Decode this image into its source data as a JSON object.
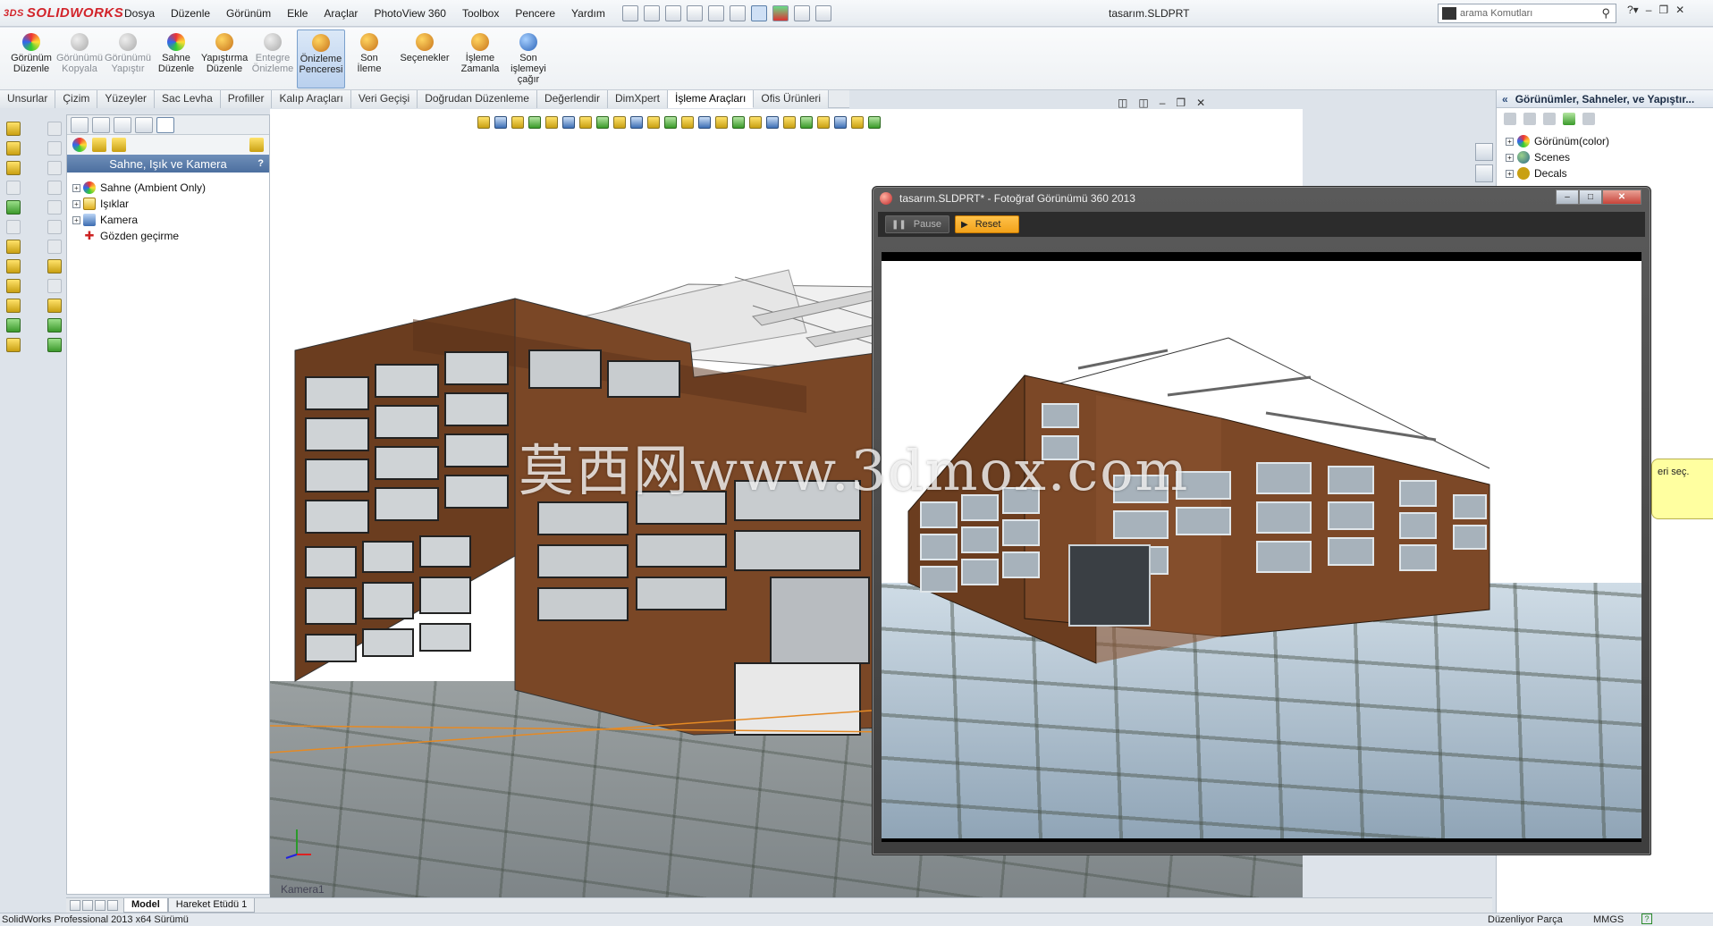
{
  "app": {
    "logo": "SOLIDWORKS",
    "menu": [
      "Dosya",
      "Düzenle",
      "Görünüm",
      "Ekle",
      "Araçlar",
      "PhotoView 360",
      "Toolbox",
      "Pencere",
      "Yardım"
    ],
    "document_title": "tasarım.SLDPRT",
    "search_placeholder": "arama Komutları"
  },
  "command_manager": {
    "buttons": [
      {
        "label": "Görünüm\nDüzenle",
        "state": "normal"
      },
      {
        "label": "Görünümü\nKopyala",
        "state": "disabled"
      },
      {
        "label": "Görünümü\nYapıştır",
        "state": "disabled"
      },
      {
        "label": "Sahne\nDüzenle",
        "state": "normal"
      },
      {
        "label": "Yapıştırma\nDüzenle",
        "state": "normal"
      },
      {
        "label": "Entegre\nÖnizleme",
        "state": "disabled"
      },
      {
        "label": "Önizleme\nPenceresi",
        "state": "active"
      },
      {
        "label": "Son\nİleme",
        "state": "normal"
      },
      {
        "label": "Seçenekler",
        "state": "normal"
      },
      {
        "label": "İşleme\nZamanla",
        "state": "normal"
      },
      {
        "label": "Son\nişlemeyi\nçağır",
        "state": "normal"
      }
    ]
  },
  "tabs": [
    "Unsurlar",
    "Çizim",
    "Yüzeyler",
    "Sac Levha",
    "Profiller",
    "Kalıp Araçları",
    "Veri Geçişi",
    "Doğrudan Düzenleme",
    "Değerlendir",
    "DimXpert",
    "İşleme Araçları",
    "Ofis Ürünleri"
  ],
  "active_tab": "İşleme Araçları",
  "feature_manager": {
    "header": "Sahne, Işık ve Kamera",
    "help": "?",
    "tree": [
      {
        "label": "Sahne (Ambient Only)",
        "icon": "scene-icon",
        "expandable": true
      },
      {
        "label": "Işıklar",
        "icon": "lights-icon",
        "expandable": true
      },
      {
        "label": "Kamera",
        "icon": "camera-icon",
        "expandable": true
      },
      {
        "label": "Gözden geçirme",
        "icon": "walkthrough-icon",
        "expandable": false
      }
    ]
  },
  "viewport": {
    "camera_label": "Kamera1"
  },
  "model_tabs": [
    "Model",
    "Hareket Etüdü 1"
  ],
  "active_model_tab": "Model",
  "status_bar": {
    "left": "SolidWorks Professional 2013 x64 Sürümü",
    "editing": "Düzenliyor Parça",
    "units": "MMGS",
    "help": "?"
  },
  "task_pane": {
    "header": "Görünümler, Sahneler, ve Yapıştır...",
    "tree": [
      {
        "label": "Görünüm(color)",
        "icon": "appearance-icon"
      },
      {
        "label": "Scenes",
        "icon": "scenes-icon"
      },
      {
        "label": "Decals",
        "icon": "decals-icon"
      }
    ],
    "note": "eri seç."
  },
  "photoview_window": {
    "title": "tasarım.SLDPRT* - Fotoğraf Görünümü 360 2013",
    "pause_label": "Pause",
    "reset_label": "Reset"
  },
  "watermark": "莫西网www.3dmox.com",
  "colors": {
    "wood": "#6b3d1f",
    "accent_active": "#b9d0ee",
    "reset_button": "#f2a21a",
    "fm_header": "#4c6f9f"
  }
}
